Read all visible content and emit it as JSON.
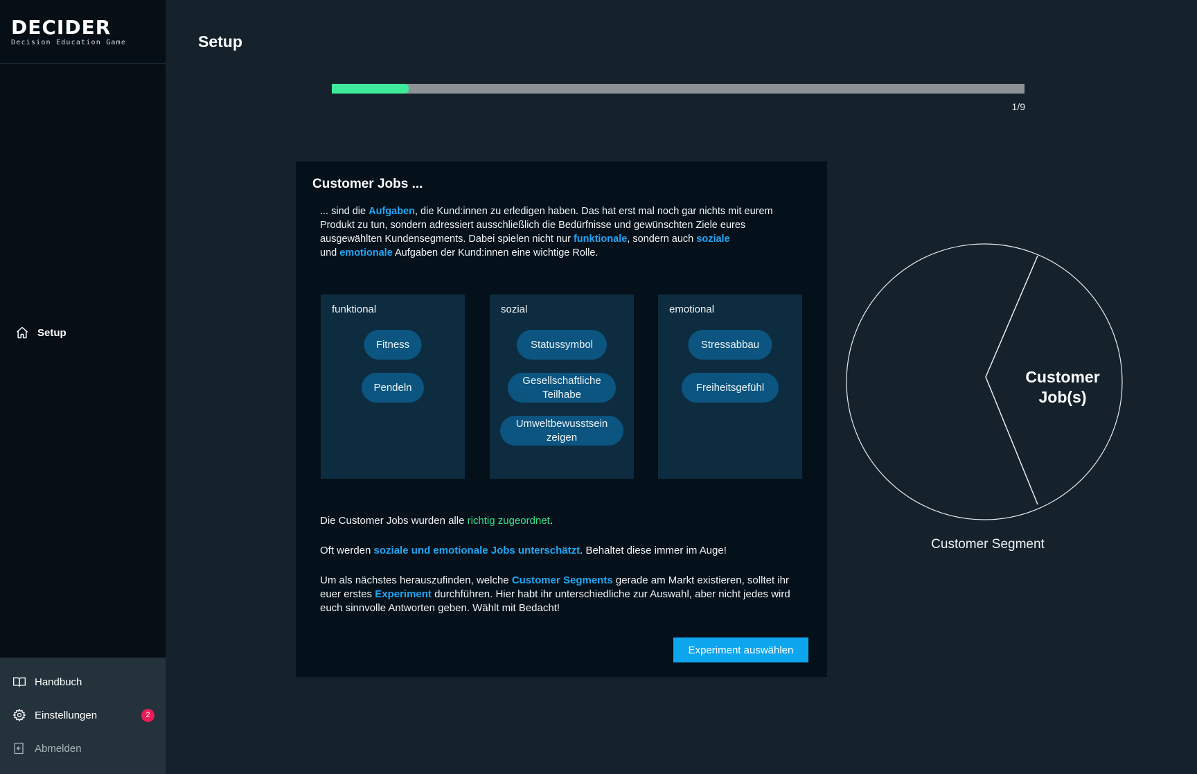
{
  "logo": {
    "title": "DECIDER",
    "subtitle": "Decision Education Game"
  },
  "nav": {
    "setup_label": "Setup"
  },
  "sidebar_bottom": {
    "items": [
      {
        "label": "Handbuch",
        "icon": "book-icon"
      },
      {
        "label": "Einstellungen",
        "icon": "gear-icon",
        "badge": "2"
      },
      {
        "label": "Abmelden",
        "icon": "logout-icon"
      }
    ]
  },
  "page": {
    "title": "Setup"
  },
  "progress": {
    "current": 1,
    "total": 9,
    "label": "1/9"
  },
  "card": {
    "title": "Customer Jobs ...",
    "intro": {
      "t1": "... sind die ",
      "h1": "Aufgaben",
      "t2": ", die Kund:innen zu erledigen haben.  Das hat erst mal noch gar nichts mit eurem Produkt zu tun, sondern adressiert ausschließlich die Bedürfnisse und gewünschten Ziele eures ausgewählten Kundensegments. Dabei spielen nicht nur ",
      "h2": "funktionale",
      "t3": ", sondern auch ",
      "h3": "soziale",
      "t4": " und ",
      "h4": "emotionale",
      "t5": " Aufgaben der Kund:innen eine wichtige Rolle."
    },
    "columns": [
      {
        "title": "funktional",
        "items": [
          "Fitness",
          "Pendeln"
        ]
      },
      {
        "title": "sozial",
        "items": [
          "Statussymbol",
          "Gesellschaftliche Teilhabe",
          "Umweltbewusstsein zeigen"
        ]
      },
      {
        "title": "emotional",
        "items": [
          "Stressabbau",
          "Freiheitsgefühl"
        ]
      }
    ],
    "result": {
      "p1a": "Die Customer Jobs wurden alle ",
      "p1b": "richtig zugeordnet",
      "p1c": ".",
      "p2a": "Oft werden ",
      "p2b": "soziale und emotionale Jobs unterschätzt",
      "p2c": ". Behaltet diese immer im Auge!",
      "p3a": "Um als nächstes herauszufinden, welche ",
      "p3b": "Customer Segments",
      "p3c": " gerade am Markt existieren, solltet ihr euer erstes ",
      "p3d": "Experiment",
      "p3e": " durchführen. Hier habt ihr unterschiedliche zur Auswahl, aber nicht jedes wird euch sinnvolle Antworten geben. Wählt mit Bedacht!"
    },
    "button_label": "Experiment auswählen"
  },
  "diagram": {
    "segment_label": "Customer Job(s)",
    "caption": "Customer Segment"
  },
  "colors": {
    "accent_blue": "#21a6f5",
    "accent_green": "#3deb9a",
    "badge_red": "#ec1c5b",
    "button_blue": "#0ea5ef"
  }
}
